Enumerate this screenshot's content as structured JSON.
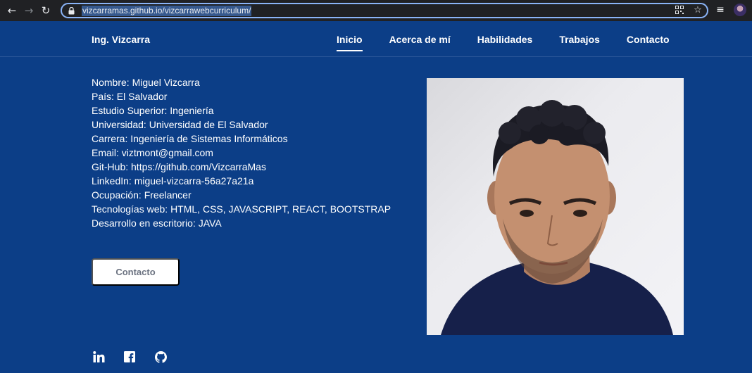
{
  "browser": {
    "url": "vizcarramas.github.io/vizcarrawebcurriculum/"
  },
  "header": {
    "brand": "Ing. Vizcarra",
    "menu": [
      {
        "label": "Inicio",
        "active": true
      },
      {
        "label": "Acerca de mí",
        "active": false
      },
      {
        "label": "Habilidades",
        "active": false
      },
      {
        "label": "Trabajos",
        "active": false
      },
      {
        "label": "Contacto",
        "active": false
      }
    ]
  },
  "profile": {
    "lines": [
      "Nombre: Miguel Vizcarra",
      "País: El Salvador",
      "Estudio Superior: Ingeniería",
      "Universidad: Universidad de El Salvador",
      "Carrera: Ingeniería de Sistemas Informáticos",
      "Email: viztmont@gmail.com",
      "Git-Hub: https://github.com/VizcarraMas",
      "LinkedIn: miguel-vizcarra-56a27a21a",
      "Ocupación: Freelancer",
      "Tecnologías web: HTML, CSS, JAVASCRIPT, REACT, BOOTSTRAP",
      "Desarrollo en escritorio: JAVA"
    ],
    "contact_button": "Contacto"
  },
  "social": {
    "icons": [
      "linkedin-icon",
      "facebook-icon",
      "github-icon"
    ]
  },
  "colors": {
    "background": "#0c3e87",
    "chrome": "#202124",
    "button_text": "#6b7280"
  }
}
